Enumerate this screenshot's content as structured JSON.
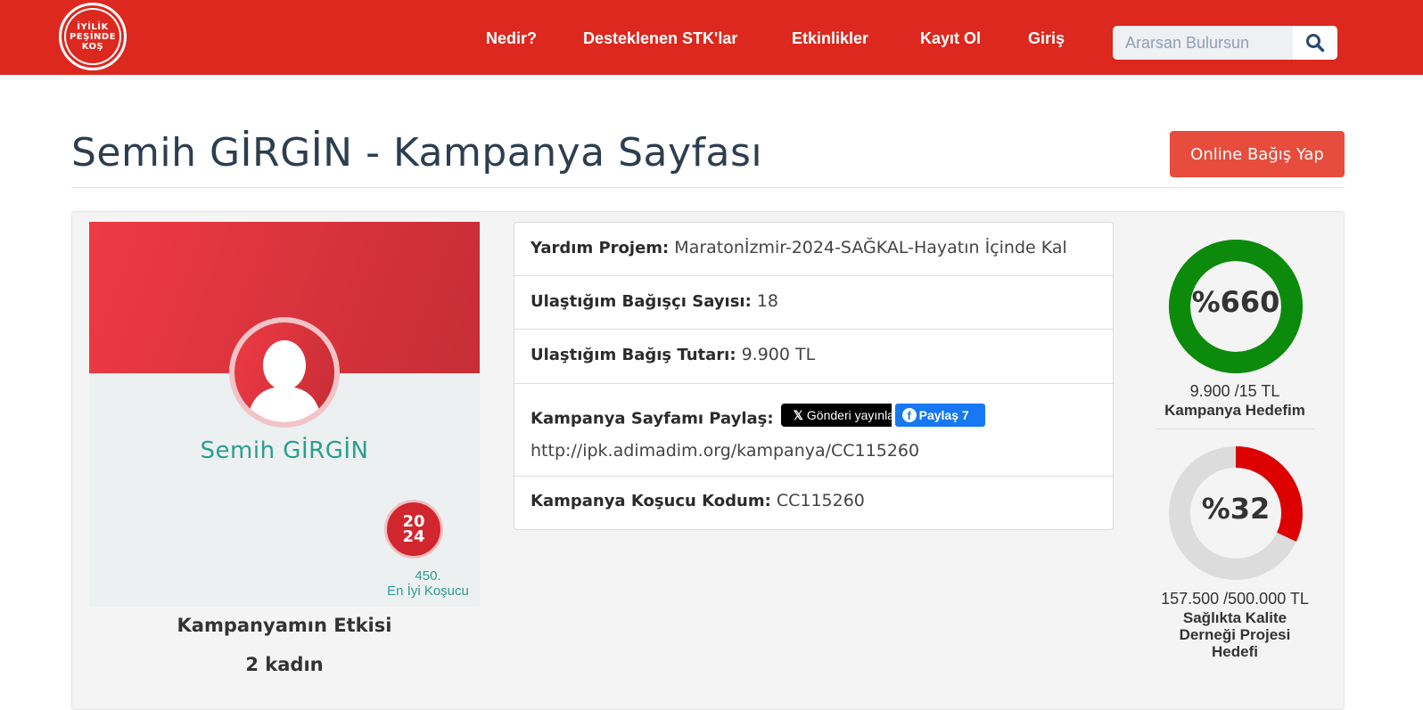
{
  "header": {
    "logo_text": "İYİLİK\nPEŞİNDE\nKOŞ",
    "nav": [
      "Nedir?",
      "Desteklenen STK'lar",
      "Etkinlikler",
      "Kayıt Ol",
      "Giriş"
    ],
    "search_placeholder": "Ararsan Bulursun"
  },
  "page": {
    "title": "Semih GİRGİN - Kampanya Sayfası",
    "donate_button": "Online Bağış Yap"
  },
  "profile": {
    "name": "Semih GİRGİN",
    "badge_text": "20\n24",
    "rank": "450.",
    "rank_label": "En İyi Koşucu",
    "impact_title": "Kampanyamın Etkisi",
    "impact_value": "2 kadın"
  },
  "info": {
    "project_label": "Yardım Projem:",
    "project_value": "Maratonİzmir-2024-SAĞKAL-Hayatın İçinde Kal",
    "donors_label": "Ulaştığım Bağışçı Sayısı:",
    "donors_value": "18",
    "amount_label": "Ulaştığım Bağış Tutarı:",
    "amount_value": "9.900 TL",
    "share_label": "Kampanya Sayfamı Paylaş:",
    "x_button": "Gönderi yayınla",
    "fb_button": "Paylaş 7",
    "share_url": "http://ipk.adimadim.org/kampanya/CC115260",
    "code_label": "Kampanya Koşucu Kodum:",
    "code_value": "CC115260"
  },
  "goals": [
    {
      "percent_text": "%660",
      "percent": 100,
      "amount": "9.900 /15 TL",
      "label": "Kampanya Hedefim",
      "color": "#0c8a0c",
      "track": "#0c8a0c"
    },
    {
      "percent_text": "%32",
      "percent": 32,
      "amount": "157.500 /500.000 TL",
      "label": "Sağlıkta Kalite Derneği Projesi Hedefi",
      "color": "#dd0000",
      "track": "#dcdcdc"
    }
  ],
  "colors": {
    "brand_red": "#dc281e",
    "title_color": "#2c3e50",
    "button_red": "#e74c3c",
    "teal": "#2a9d8f"
  }
}
